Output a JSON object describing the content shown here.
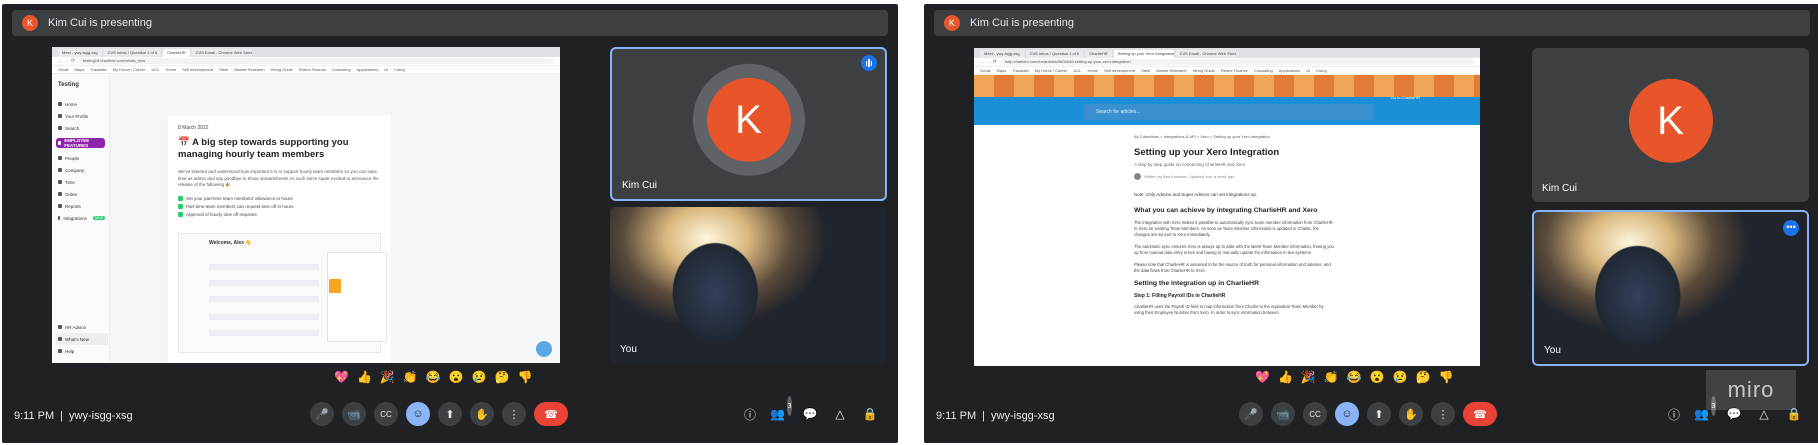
{
  "presenting_banner": "Kim Cui is presenting",
  "presenter_initial": "K",
  "participants": {
    "kim_name": "Kim Cui",
    "you_name": "You",
    "kim_initial": "K"
  },
  "footer": {
    "time": "9:11 PM",
    "separator": "|",
    "meeting_code": "ywy-isgg-xsg"
  },
  "people_count": "3",
  "reactions": [
    "💖",
    "👍",
    "🎉",
    "👏",
    "😂",
    "😮",
    "😢",
    "🤔",
    "👎"
  ],
  "controls": {
    "mic": "🎤",
    "camera": "📹",
    "captions": "CC",
    "emoji": "☺",
    "present": "⬆",
    "raise_hand": "✋",
    "more": "⋮",
    "end_call": "☎",
    "info": "ⓘ",
    "people": "👥",
    "chat": "💬",
    "activities": "△",
    "host": "🔒"
  },
  "left_screen": {
    "tabs": [
      "Meet - ywy-isgg-xsg",
      "CVS Inbox / Question 1 of 6",
      "CharlieHR",
      "CVS Email - Chrome Web Store"
    ],
    "url": "testing18.charliehr.com/whats_new",
    "bookmarks": [
      "Gmail",
      "Maps",
      "Translate",
      "My Home / Career",
      "UCL",
      "Home",
      "Self development",
      "Steel",
      "Market Research",
      "Hiring Guide",
      "Redux Finance",
      "Consulting",
      "Applications",
      "UI",
      "Living"
    ],
    "workspace": "Testing",
    "nav": [
      "Home",
      "Your Profile",
      "Search",
      "EMPLOYEE FEATURES",
      "People",
      "Company",
      "Time",
      "Onlee",
      "Reports",
      "Integrations"
    ],
    "new_badge": "NEW",
    "bottom_nav": [
      "HR Advice",
      "What's New",
      "Help"
    ],
    "date": "8 March 2022",
    "title": "📅 A big step towards supporting you managing hourly team members",
    "para": "We've listened and understood how important it is to support hourly team members so you can save time as admin and say goodbye to those spreadsheets! As such we're super excited to announce the release of the following 🎉",
    "checks": [
      "Set your part-time team members' allowance to hours",
      "Part-time team members can request time off in hours",
      "Approval of hourly time off requests"
    ],
    "mock_title": "Welcome, Alex 👋"
  },
  "right_screen": {
    "tabs": [
      "Meet - ywy-isgg-xsg",
      "CVS Inbox / Question 1 of 6",
      "CharlieHR",
      "Setting up your Xero Integration",
      "CVS Email - Chrome Web Store"
    ],
    "url": "help.charliehr.com/en/articles/5604646-setting-up-your-xero-integration",
    "bookmarks": [
      "Gmail",
      "Maps",
      "Translate",
      "My Home / Career",
      "UCL",
      "Home",
      "Self development",
      "Steel",
      "Market Research",
      "Hiring Guide",
      "Redux Finance",
      "Consulting",
      "Applications",
      "UI",
      "Living"
    ],
    "search_placeholder": "Search for articles...",
    "goto": "Go to CharlieHR",
    "breadcrumb": "All Collections > Integrations & API > Xero > Setting up your Xero Integration",
    "title": "Setting up your Xero Integration",
    "subtitle": "A step by step guide on connecting CharlieHR and Xero",
    "author": "Written by Ben Andrews. Updated over a week ago",
    "note": "Note: Only Admins and Super Admins can set integrations up.",
    "h2": "What you can achieve by integrating CharlieHR and Xero",
    "p1": "The integration with Xero makes it possible to automatically sync team member information from CharlieHR to Xero for existing Team Members. As soon as Team Member information is updated in Charlie, the changes are synced to Xero immediately.",
    "p2": "The automatic sync ensures Xero is always up to date with the latest Team Member information, freeing you up from manual data entry errors and having to manually update the information in two systems.",
    "p3": "Please note that CharlieHR is assumed to be the source of truth for personal information and salaries, and the data flows from CharlieHR to Xero.",
    "h2b": "Setting the integration up in CharlieHR",
    "h3": "Step 1: Filling Payroll IDs in CharlieHR",
    "p4": "CharlieHR uses the Payroll ID field to map information from Charlie to the equivalent Team Member by using their Employee Number from Xero. In order to sync information between"
  },
  "watermark": "miro"
}
